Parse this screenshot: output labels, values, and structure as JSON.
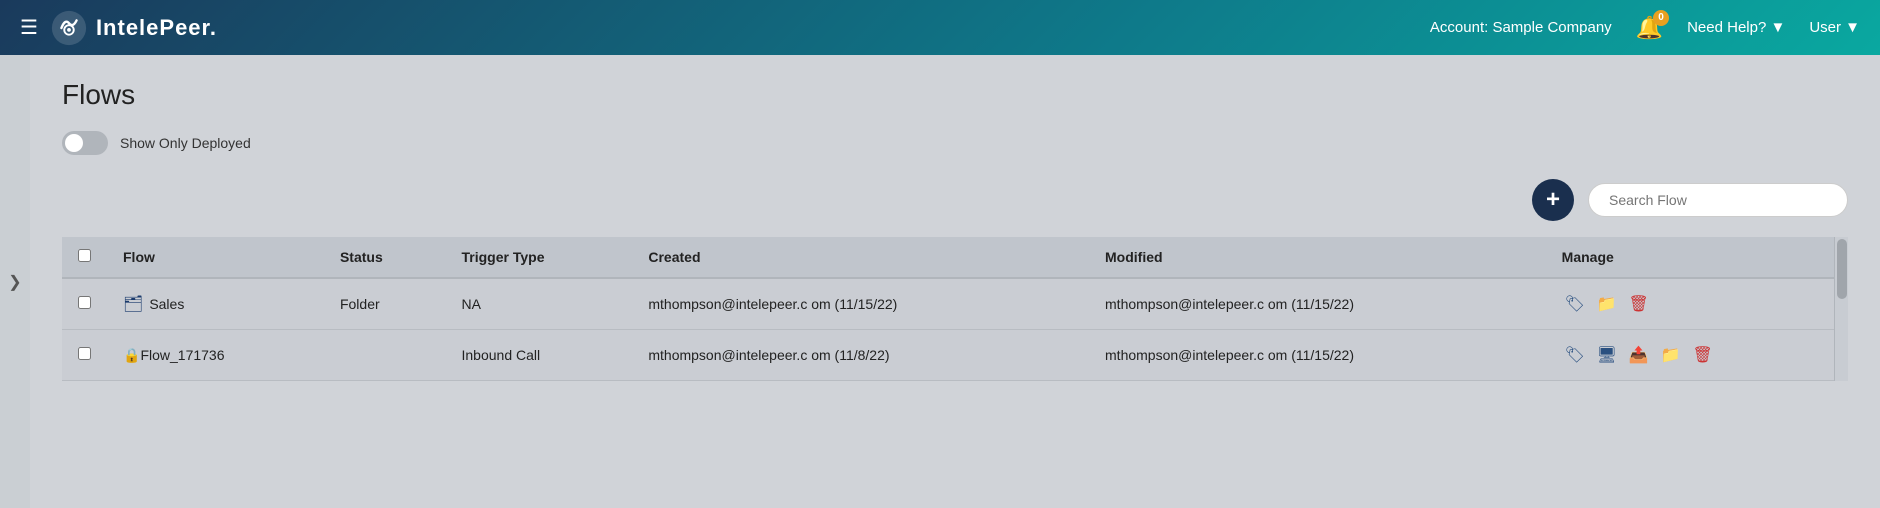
{
  "header": {
    "hamburger_label": "☰",
    "logo_text": "IntelePeer.",
    "account_label": "Account: Sample Company",
    "bell_badge": "0",
    "need_help_label": "Need Help? ▼",
    "user_label": "User ▼"
  },
  "sidebar_toggle": {
    "icon": "❯"
  },
  "page": {
    "title": "Flows",
    "toggle_label": "Show Only Deployed",
    "add_button_label": "+",
    "search_placeholder": "Search Flow"
  },
  "table": {
    "columns": [
      {
        "id": "checkbox",
        "label": ""
      },
      {
        "id": "flow",
        "label": "Flow"
      },
      {
        "id": "status",
        "label": "Status"
      },
      {
        "id": "trigger_type",
        "label": "Trigger Type"
      },
      {
        "id": "created",
        "label": "Created"
      },
      {
        "id": "modified",
        "label": "Modified"
      },
      {
        "id": "manage",
        "label": "Manage"
      }
    ],
    "rows": [
      {
        "id": "row1",
        "checkbox": "",
        "icon_type": "folder",
        "name": "Sales",
        "status": "Folder",
        "trigger_type": "NA",
        "created": "mthompson@intelepeer.c om (11/15/22)",
        "modified": "mthompson@intelepeer.c om (11/15/22)"
      },
      {
        "id": "row2",
        "checkbox": "",
        "icon_type": "lock",
        "name": "Flow_171736",
        "status": "",
        "trigger_type": "Inbound Call",
        "created": "mthompson@intelepeer.c om (11/8/22)",
        "modified": "mthompson@intelepeer.c om (11/15/22)"
      }
    ]
  }
}
